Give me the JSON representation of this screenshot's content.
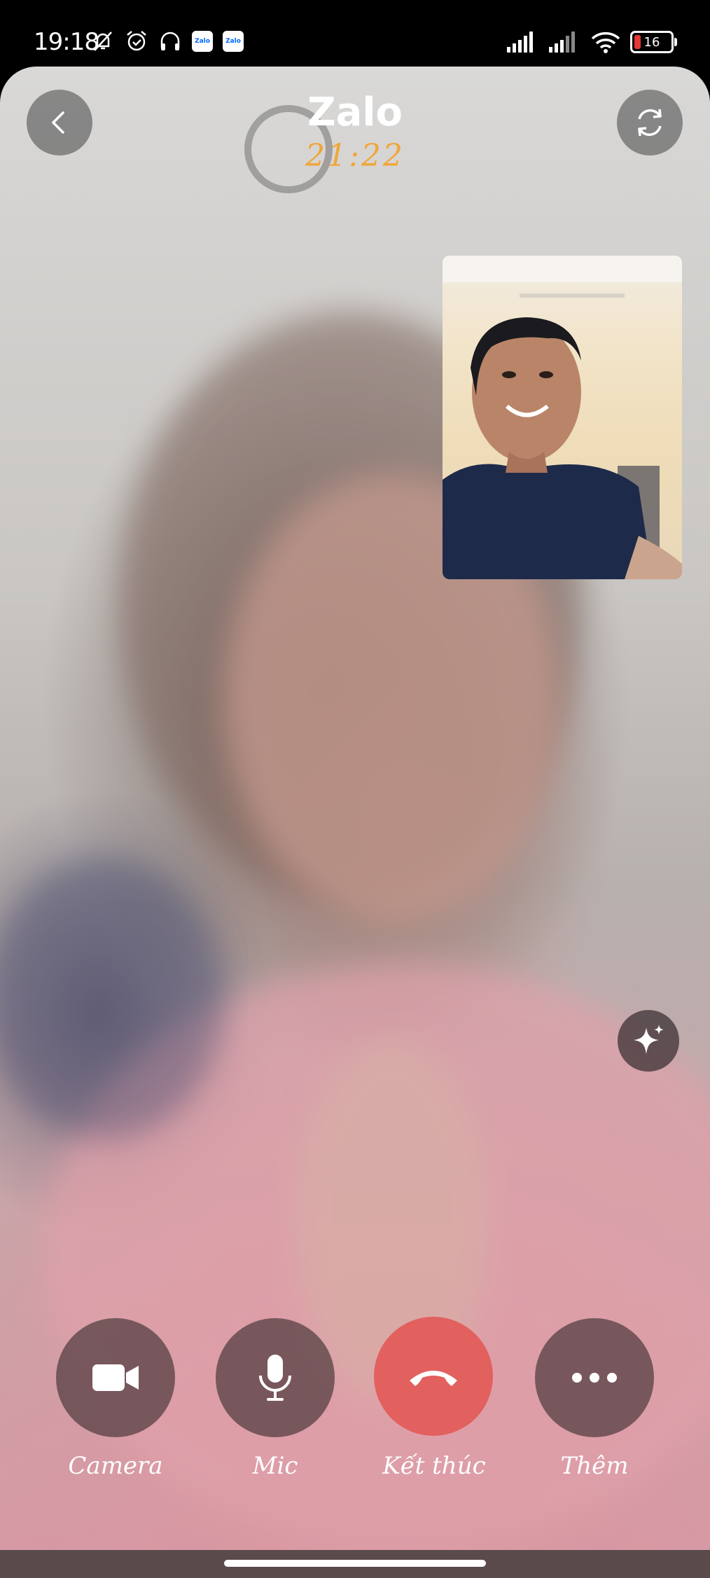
{
  "status_bar": {
    "time": "19:18",
    "left_icons": [
      "bell-off-icon",
      "alarm-icon",
      "headphones-icon",
      "zalo-notification-icon",
      "zalo-notification-icon"
    ],
    "zalo_chip_text": "Zalo",
    "battery_level": "16",
    "right_icons": [
      "cell-signal-icon",
      "cell-signal-icon",
      "wifi-icon",
      "battery-icon"
    ]
  },
  "header": {
    "title": "Zalo",
    "call_timer": "21:22",
    "back_icon": "chevron-left-icon",
    "switch_camera_icon": "camera-switch-icon"
  },
  "effects_icon": "sparkle-icon",
  "controls": [
    {
      "label": "Camera",
      "icon": "video-camera-icon"
    },
    {
      "label": "Mic",
      "icon": "microphone-icon"
    },
    {
      "label": "Kết thúc",
      "icon": "hang-up-icon",
      "color": "#e2605e"
    },
    {
      "label": "Thêm",
      "icon": "more-dots-icon"
    }
  ],
  "colors": {
    "accent_timer": "#f0a63a",
    "end_call": "#e2605e"
  }
}
